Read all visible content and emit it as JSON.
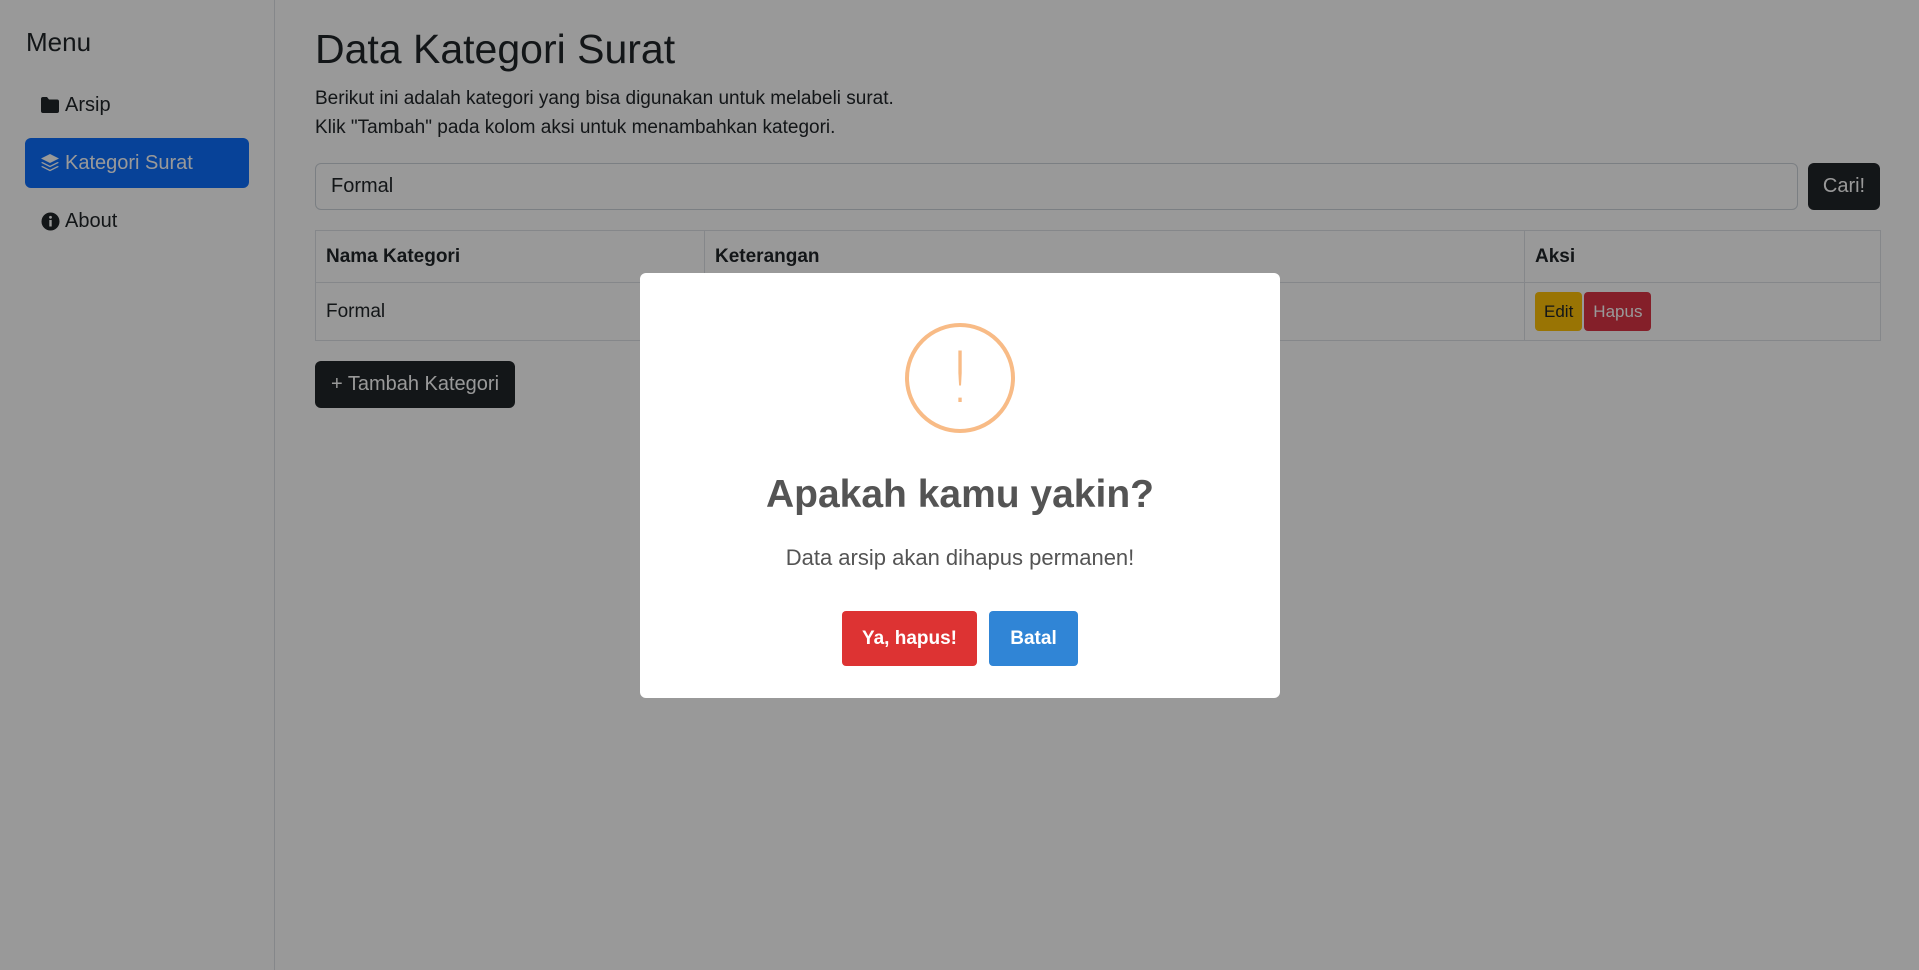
{
  "sidebar": {
    "title": "Menu",
    "items": [
      {
        "label": "Arsip",
        "icon": "folder-icon",
        "active": false
      },
      {
        "label": "Kategori Surat",
        "icon": "layers-icon",
        "active": true
      },
      {
        "label": "About",
        "icon": "info-icon",
        "active": false
      }
    ]
  },
  "main": {
    "title": "Data Kategori Surat",
    "desc1": "Berikut ini adalah kategori yang bisa digunakan untuk melabeli surat.",
    "desc2": "Klik \"Tambah\" pada kolom aksi untuk menambahkan kategori.",
    "search": {
      "value": "Formal",
      "button": "Cari!"
    },
    "table": {
      "headers": [
        "Nama Kategori",
        "Keterangan",
        "Aksi"
      ],
      "rows": [
        {
          "nama": "Formal",
          "keterangan": "",
          "edit": "Edit",
          "hapus": "Hapus"
        }
      ]
    },
    "add_button": "+ Tambah Kategori"
  },
  "dialog": {
    "icon": "!",
    "title": "Apakah kamu yakin?",
    "text": "Data arsip akan dihapus permanen!",
    "confirm": "Ya, hapus!",
    "cancel": "Batal"
  },
  "colors": {
    "primary": "#0d6efd",
    "dark": "#212529",
    "warning": "#ffc107",
    "danger": "#dc3545",
    "confirm": "#dd3333",
    "cancel": "#3085d6",
    "alert_icon": "#f8bb86"
  }
}
